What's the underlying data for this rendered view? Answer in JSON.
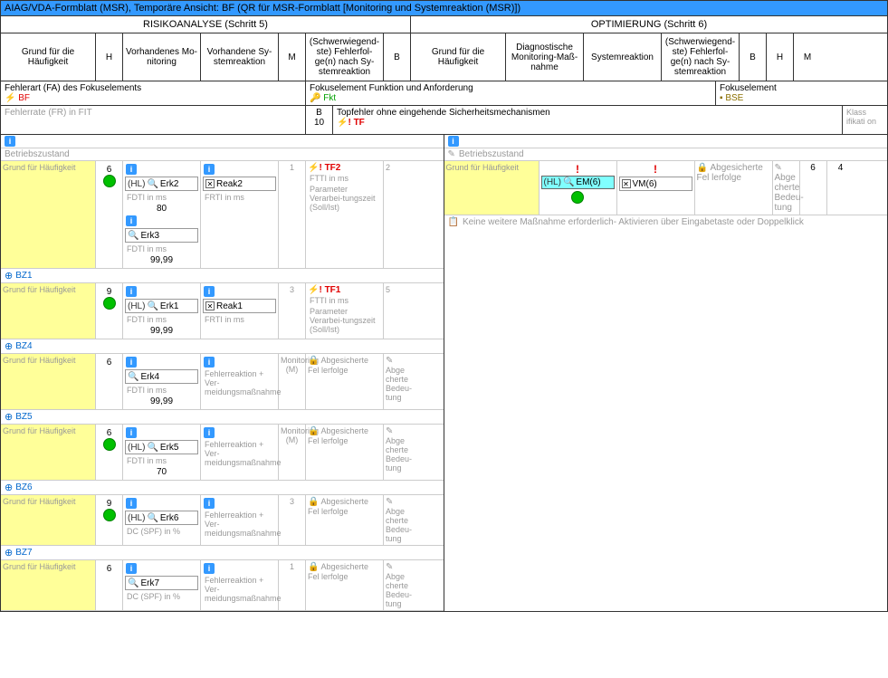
{
  "title": "AIAG/VDA-Formblatt (MSR), Temporäre Ansicht: BF (QR für MSR-Formblatt [Monitoring und Systemreaktion (MSR)])",
  "hdr": {
    "left": "RISIKOANALYSE (Schritt 5)",
    "right": "OPTIMIERUNG (Schritt 6)"
  },
  "cols": {
    "c1": "Grund für die Häufigkeit",
    "c2": "H",
    "c3": "Vorhandenes Mo-nitoring",
    "c4": "Vorhandene Sy-stemreaktion",
    "c5": "M",
    "c6": "(Schwerwiegend-ste) Fehlerfol-ge(n) nach Sy-stemreaktion",
    "c7": "B",
    "c8": "Grund für die Häufigkeit",
    "c9": "Diagnostische Monitoring-Maß-nahme",
    "c10": "Systemreaktion",
    "c11": "(Schwerwiegend-ste) Fehlerfol-ge(n) nach Sy-stemreaktion",
    "c12": "B",
    "c13": "H",
    "c14": "M"
  },
  "r3": {
    "a_lbl": "Fehlerart (FA) des Fokuselements",
    "a_val": "BF",
    "b_lbl": "Fokuselement Funktion und Anforderung",
    "b_val": "Fkt",
    "c_lbl": "Fokuselement",
    "c_val": "BSE"
  },
  "r4": {
    "a": "Fehlerrate (FR) in FIT",
    "b1": "B",
    "b2": "10",
    "c": "Topfehler ohne eingehende Sicherheitsmechanismen",
    "c_tf": "TF",
    "d": "Klass ifikati on"
  },
  "bz_lbl": "Betriebszustand",
  "gfh": "Grund für Häufigkeit",
  "fdti": "FDTI in ms",
  "frti": "FRTI in ms",
  "ftti": "FTTI in ms",
  "pvz": "Parameter Verarbei-tungszeit (Soll/Ist)",
  "dcspf": "DC (SPF) in %",
  "frvm": "Fehlerreaktion + Ver-meidungsmaßnahme",
  "mon_m": "Monitoring (M)",
  "agf": "Abgesicherte Fel lerfolge",
  "agb": "Abge cherte Bedeu-tung",
  "hl": "(HL)",
  "rows": [
    {
      "bz": null,
      "h": "6",
      "dot": true,
      "erk": [
        {
          "n": "Erk2",
          "hl": true,
          "sub": "80"
        },
        {
          "n": "Erk3",
          "hl": false,
          "sub": "99,99"
        }
      ],
      "reak": "Reak2",
      "m": "1",
      "tf": "TF2",
      "b": "2"
    },
    {
      "bz": "BZ1",
      "h": "9",
      "dot": true,
      "erk": [
        {
          "n": "Erk1",
          "hl": true,
          "sub": "99,99"
        }
      ],
      "reak": "Reak1",
      "m": "3",
      "tf": "TF1",
      "b": "5"
    },
    {
      "bz": "BZ4",
      "h": "6",
      "dot": false,
      "erk": [
        {
          "n": "Erk4",
          "hl": false,
          "sub": "99,99"
        }
      ],
      "reak": null,
      "m": null,
      "tf": null,
      "b": null,
      "empty": true
    },
    {
      "bz": "BZ5",
      "h": "6",
      "dot": true,
      "erk": [
        {
          "n": "Erk5",
          "hl": true,
          "sub": "70"
        }
      ],
      "reak": null,
      "m": null,
      "tf": null,
      "b": null,
      "empty": true
    },
    {
      "bz": "BZ6",
      "h": "9",
      "dot": true,
      "erk": [
        {
          "n": "Erk6",
          "hl": true,
          "sub": null,
          "dcspf": true
        }
      ],
      "reak": null,
      "m": "3",
      "tf": null,
      "b": null,
      "empty2": true
    },
    {
      "bz": "BZ7",
      "h": "6",
      "dot": false,
      "erk": [
        {
          "n": "Erk7",
          "hl": false,
          "sub": null,
          "dcspf": true
        }
      ],
      "reak": null,
      "m": "1",
      "tf": null,
      "b": null,
      "empty2": true
    }
  ],
  "right_row": {
    "em": "EM(6)",
    "vm": "VM(6)",
    "b": "6",
    "h": "4"
  },
  "note": "Keine weitere Maßnahme erforderlich- Aktivieren über Eingabetaste oder Doppelklick"
}
